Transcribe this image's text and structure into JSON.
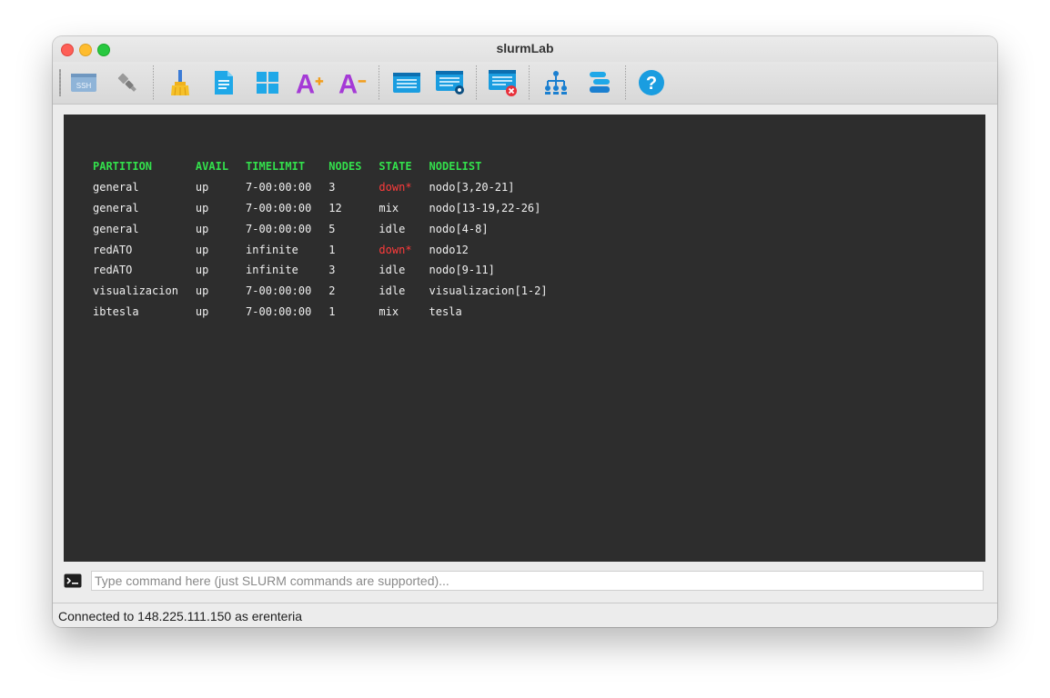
{
  "window": {
    "title": "slurmLab"
  },
  "toolbar": {
    "buttons": [
      {
        "name": "ssh-connect-button",
        "icon": "ssh-icon",
        "label": "SSH"
      },
      {
        "name": "disconnect-button",
        "icon": "plug-icon"
      },
      {
        "name": "clear-button",
        "icon": "broom-icon"
      },
      {
        "name": "script-button",
        "icon": "document-icon"
      },
      {
        "name": "layout-button",
        "icon": "grid-icon"
      },
      {
        "name": "font-increase-button",
        "icon": "font-increase-icon",
        "label": "A+"
      },
      {
        "name": "font-decrease-button",
        "icon": "font-decrease-icon",
        "label": "A-"
      },
      {
        "name": "queue-button",
        "icon": "list-window-icon"
      },
      {
        "name": "job-info-button",
        "icon": "list-window-info-icon"
      },
      {
        "name": "cancel-job-button",
        "icon": "list-window-cancel-icon"
      },
      {
        "name": "partition-tree-button",
        "icon": "hierarchy-icon"
      },
      {
        "name": "nodes-button",
        "icon": "stack-icon"
      },
      {
        "name": "help-button",
        "icon": "help-icon",
        "label": "?"
      }
    ]
  },
  "terminal": {
    "headers": [
      "PARTITION",
      "AVAIL",
      "TIMELIMIT",
      "NODES",
      "STATE",
      "NODELIST"
    ],
    "rows": [
      [
        "general",
        "up",
        "7-00:00:00",
        "3",
        "down*",
        "nodo[3,20-21]"
      ],
      [
        "general",
        "up",
        "7-00:00:00",
        "12",
        "mix",
        "nodo[13-19,22-26]"
      ],
      [
        "general",
        "up",
        "7-00:00:00",
        "5",
        "idle",
        "nodo[4-8]"
      ],
      [
        "redATO",
        "up",
        "infinite",
        "1",
        "down*",
        "nodo12"
      ],
      [
        "redATO",
        "up",
        "infinite",
        "3",
        "idle",
        "nodo[9-11]"
      ],
      [
        "visualizacion",
        "up",
        "7-00:00:00",
        "2",
        "idle",
        "visualizacion[1-2]"
      ],
      [
        "ibtesla",
        "up",
        "7-00:00:00",
        "1",
        "mix",
        "tesla"
      ]
    ]
  },
  "command": {
    "value": "",
    "placeholder": "Type command here (just SLURM commands are supported)..."
  },
  "status": {
    "text": "Connected to 148.225.111.150 as erenteria"
  },
  "colors": {
    "header_green": "#33e04c",
    "down_red": "#ff3b3b",
    "terminal_bg": "#2d2d2d"
  }
}
